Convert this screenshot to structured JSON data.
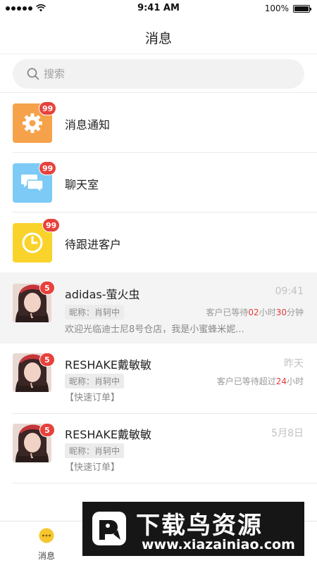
{
  "status_bar": {
    "time": "9:41 AM",
    "battery": "100%"
  },
  "header": {
    "title": "消息"
  },
  "search": {
    "placeholder": "搜索"
  },
  "categories": [
    {
      "label": "消息通知",
      "badge": "99",
      "color": "#f5a24b",
      "icon": "gear-icon"
    },
    {
      "label": "聊天室",
      "badge": "99",
      "color": "#7ccaf5",
      "icon": "chat-bubbles-icon"
    },
    {
      "label": "待跟进客户",
      "badge": "99",
      "color": "#f9d32b",
      "icon": "clock-icon"
    }
  ],
  "chats": [
    {
      "name": "adidas-萤火虫",
      "time": "09:41",
      "badge": "5",
      "nickname": "昵称：肖轲中",
      "wait": {
        "prefix": "客户已等待",
        "h": "02",
        "mid": "小时",
        "m": "30",
        "suffix": "分钟"
      },
      "preview": "欢迎光临迪士尼8号仓店，我是小蜜蜂米妮..."
    },
    {
      "name": "RESHAKE戴敏敏",
      "time": "昨天",
      "badge": "5",
      "nickname": "昵称：肖轲中",
      "wait": {
        "prefix": "客户已等待超过",
        "h": "24",
        "suffix": "小时"
      },
      "preview": "【快速订单】"
    },
    {
      "name": "RESHAKE戴敏敏",
      "time": "5月8日",
      "badge": "5",
      "nickname": "昵称：肖轲中",
      "preview": "【快速订单】"
    }
  ],
  "tabs": [
    {
      "label": "消息"
    },
    {
      "label": ""
    },
    {
      "label": ""
    },
    {
      "label": ""
    }
  ],
  "watermark": {
    "title": "下载鸟资源",
    "url": "www.xiazainiao.com"
  },
  "colors": {
    "badge_red": "#e8413c",
    "highlight_row": "#f4f4f4",
    "wait_red": "#e33b3b"
  }
}
